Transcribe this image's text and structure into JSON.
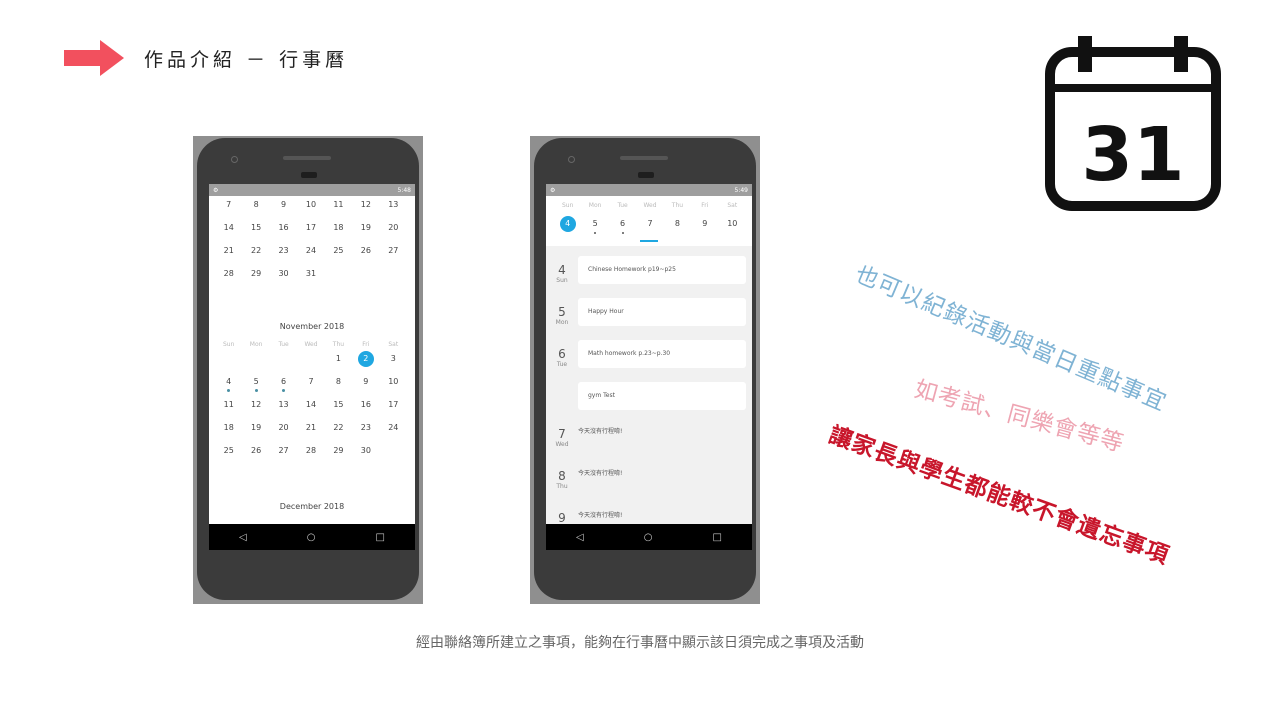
{
  "header": {
    "title": "作品介紹 － 行事曆",
    "arrow_color": "#f2505e"
  },
  "calendar_icon": {
    "number": "31"
  },
  "phone1": {
    "status_time": "5:48",
    "october_rows": [
      [
        "7",
        "8",
        "9",
        "10",
        "11",
        "12",
        "13"
      ],
      [
        "14",
        "15",
        "16",
        "17",
        "18",
        "19",
        "20"
      ],
      [
        "21",
        "22",
        "23",
        "24",
        "25",
        "26",
        "27"
      ],
      [
        "28",
        "29",
        "30",
        "31",
        "",
        "",
        ""
      ]
    ],
    "november_title": "November 2018",
    "dow": [
      "Sun",
      "Mon",
      "Tue",
      "Wed",
      "Thu",
      "Fri",
      "Sat"
    ],
    "november_rows": [
      [
        "",
        "",
        "",
        "",
        "1",
        "2",
        "3"
      ],
      [
        "4",
        "5",
        "6",
        "7",
        "8",
        "9",
        "10"
      ],
      [
        "11",
        "12",
        "13",
        "14",
        "15",
        "16",
        "17"
      ],
      [
        "18",
        "19",
        "20",
        "21",
        "22",
        "23",
        "24"
      ],
      [
        "25",
        "26",
        "27",
        "28",
        "29",
        "30",
        ""
      ]
    ],
    "selected_day": "2",
    "december_title": "December 2018"
  },
  "phone2": {
    "status_time": "5:49",
    "dow": [
      "Sun",
      "Mon",
      "Tue",
      "Wed",
      "Thu",
      "Fri",
      "Sat"
    ],
    "week_days": [
      "4",
      "5",
      "6",
      "7",
      "8",
      "9",
      "10"
    ],
    "agenda": [
      {
        "num": "4",
        "dow": "Sun",
        "event": "Chinese Homework p19~p25"
      },
      {
        "num": "5",
        "dow": "Mon",
        "event": "Happy Hour"
      },
      {
        "num": "6",
        "dow": "Tue",
        "event": "Math homework p.23~p.30"
      },
      {
        "num": "",
        "dow": "",
        "event": "gym Test"
      },
      {
        "num": "7",
        "dow": "Wed",
        "event": "今天沒有行程唷!"
      },
      {
        "num": "8",
        "dow": "Thu",
        "event": "今天沒有行程唷!"
      },
      {
        "num": "9",
        "dow": "",
        "event": "今天沒有行程唷!"
      }
    ]
  },
  "slant_texts": {
    "line1": "也可以紀錄活動與當日重點事宜",
    "line2": "如考試、同樂會等等",
    "line3": "讓家長與學生都能較不會遺忘事項"
  },
  "caption": "經由聯絡簿所建立之事項，能夠在行事曆中顯示該日須完成之事項及活動",
  "colors": {
    "accent_blue": "#1fa7e1",
    "slant1": "#7fb3d4",
    "slant2": "#eea4b2",
    "slant3": "#c8162b"
  }
}
